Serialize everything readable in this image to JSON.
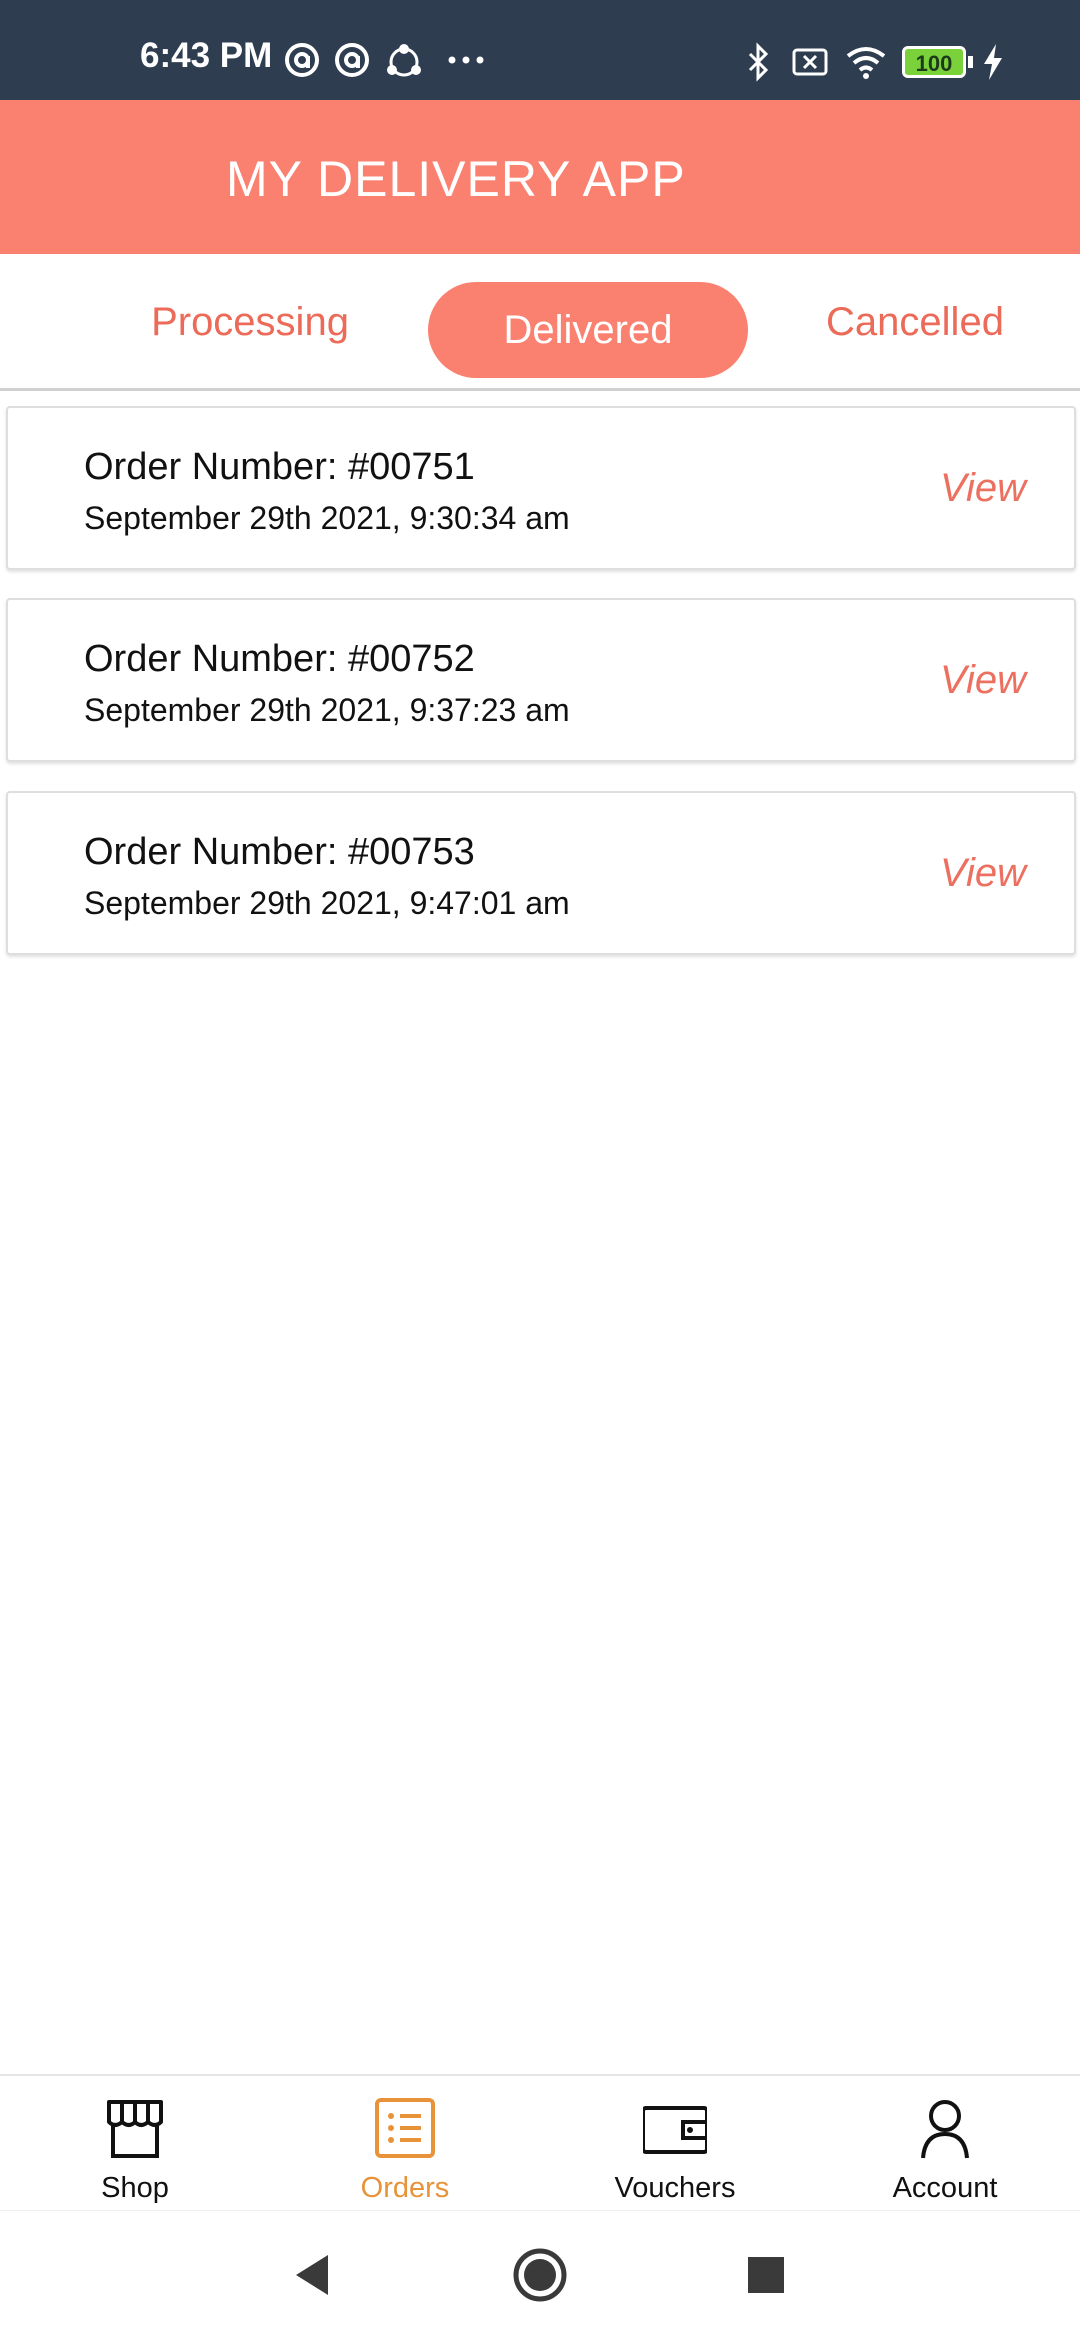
{
  "status_bar": {
    "time": "6:43 PM",
    "battery": "100",
    "left_icons": [
      "at-icon",
      "at-icon",
      "share-icon",
      "more-dots-icon"
    ],
    "right_icons": [
      "bluetooth-icon",
      "sim-off-icon",
      "wifi-icon",
      "battery-icon",
      "charging-icon"
    ]
  },
  "header": {
    "title": "MY DELIVERY APP",
    "color": "#fa8070"
  },
  "tabs": {
    "processing": "Processing",
    "delivered": "Delivered",
    "cancelled": "Cancelled",
    "selected": "Delivered",
    "accent_color": "#ec6a58"
  },
  "orders": [
    {
      "number": "Order Number: #00751",
      "date": "September 29th 2021, 9:30:34 am",
      "action": "View"
    },
    {
      "number": "Order Number: #00752",
      "date": "September 29th 2021, 9:37:23 am",
      "action": "View"
    },
    {
      "number": "Order Number: #00753",
      "date": "September 29th 2021, 9:47:01 am",
      "action": "View"
    }
  ],
  "bottom_nav": {
    "items": [
      {
        "label": "Shop",
        "icon": "store-icon"
      },
      {
        "label": "Orders",
        "icon": "orders-list-icon"
      },
      {
        "label": "Vouchers",
        "icon": "wallet-icon"
      },
      {
        "label": "Account",
        "icon": "account-icon"
      }
    ],
    "active": "Orders",
    "active_color": "#e8923a"
  },
  "system_nav": {
    "buttons": [
      "back-icon",
      "home-icon",
      "recents-icon"
    ]
  }
}
